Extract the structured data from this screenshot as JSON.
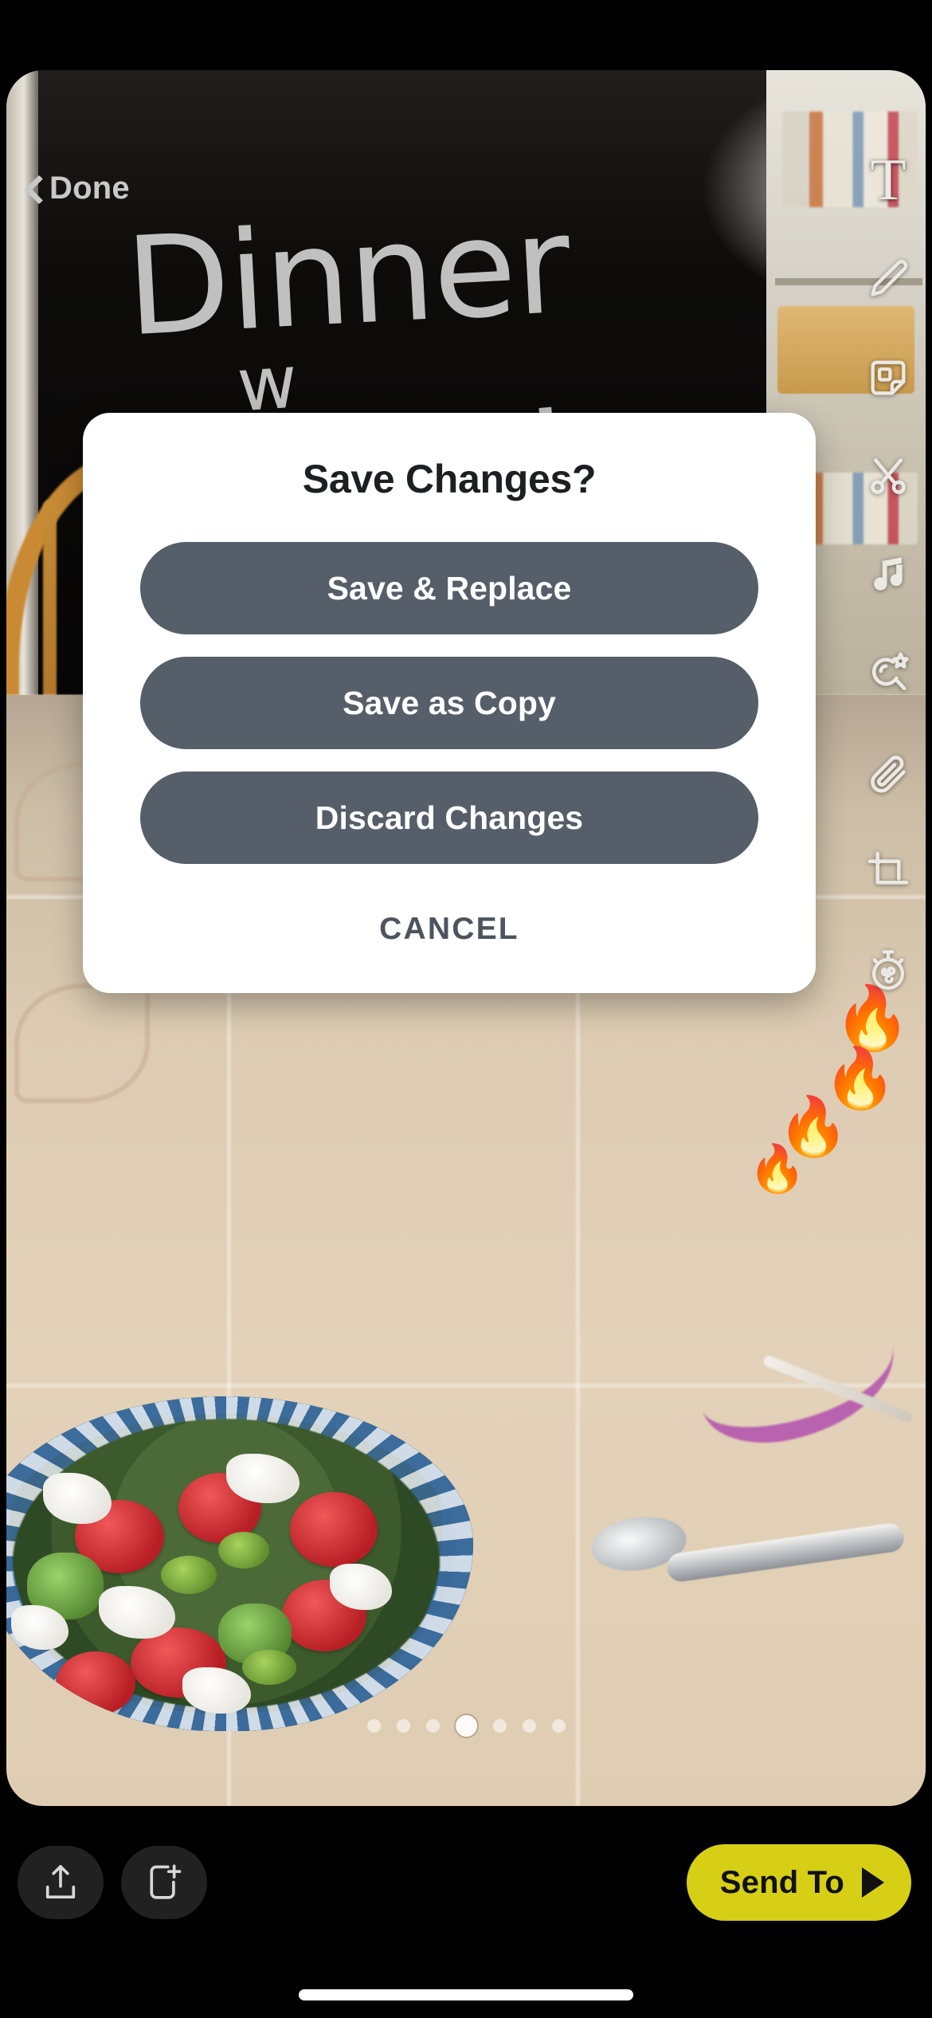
{
  "top_bar": {
    "done_label": "Done",
    "back_icon": "chevron-left-icon"
  },
  "drawing": {
    "line1": "Dinner",
    "line2": "w",
    "line3": "Sprinkles",
    "stroke_color": "#c0c0c0"
  },
  "stickers": [
    {
      "name": "fire-emoji",
      "glyph": "🔥"
    },
    {
      "name": "fire-emoji",
      "glyph": "🔥"
    },
    {
      "name": "fire-emoji",
      "glyph": "🔥"
    },
    {
      "name": "fire-emoji",
      "glyph": "🔥"
    }
  ],
  "tool_rail": {
    "items": [
      {
        "name": "text-tool",
        "icon": "text-T-icon",
        "glyph": "T"
      },
      {
        "name": "draw-tool",
        "icon": "pencil-icon"
      },
      {
        "name": "sticker-tool",
        "icon": "sticker-icon"
      },
      {
        "name": "scissors-tool",
        "icon": "scissors-icon"
      },
      {
        "name": "music-tool",
        "icon": "music-note-icon"
      },
      {
        "name": "scan-tool",
        "icon": "scan-star-icon"
      },
      {
        "name": "link-tool",
        "icon": "paperclip-icon"
      },
      {
        "name": "crop-tool",
        "icon": "crop-icon"
      },
      {
        "name": "timer-tool",
        "icon": "timer-infinity-icon"
      }
    ]
  },
  "carousel": {
    "count": 7,
    "active_index": 3
  },
  "bottom_bar": {
    "save_icon": "download-save-icon",
    "add_story_icon": "add-to-story-icon",
    "send_to_label": "Send To",
    "send_arrow_icon": "arrow-right-icon",
    "send_to_color": "#d6cf16"
  },
  "dialog": {
    "title": "Save Changes?",
    "buttons": [
      {
        "label": "Save & Replace",
        "name": "save-and-replace-button"
      },
      {
        "label": "Save as Copy",
        "name": "save-as-copy-button"
      },
      {
        "label": "Discard Changes",
        "name": "discard-changes-button"
      }
    ],
    "cancel_label": "CANCEL",
    "button_color": "#565f69",
    "title_color": "#1d1f22",
    "cancel_color": "#4c545e"
  }
}
